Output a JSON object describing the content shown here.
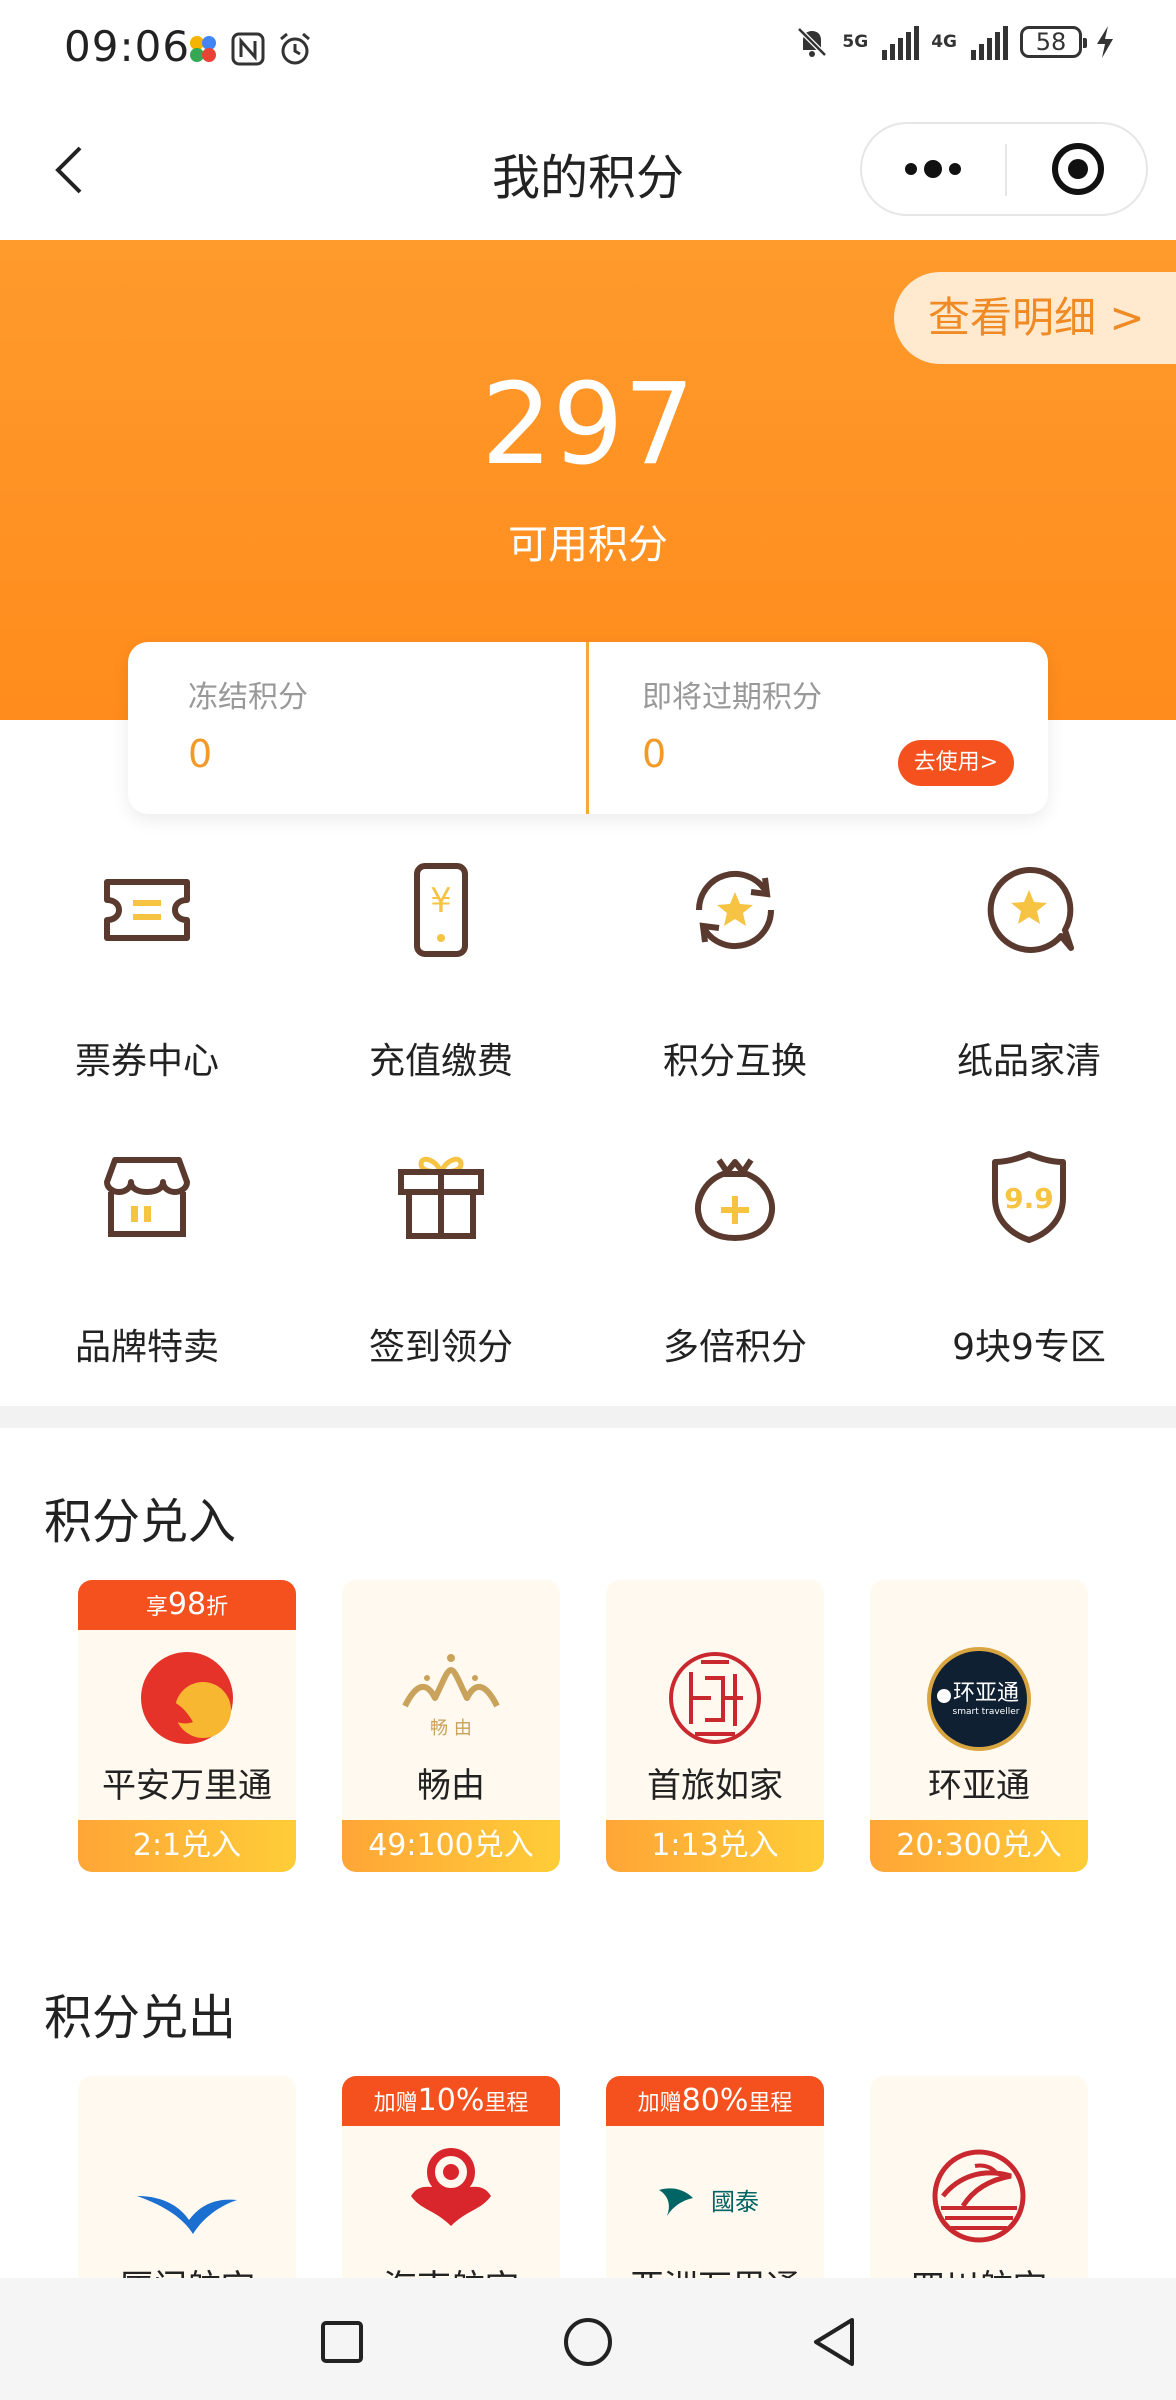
{
  "status_bar": {
    "time": "09:06",
    "net1": "5G",
    "net2": "4G",
    "battery": "58"
  },
  "nav": {
    "title": "我的积分"
  },
  "hero": {
    "detail_label": "查看明细 >",
    "points": "297",
    "points_label": "可用积分"
  },
  "summary": {
    "frozen_label": "冻结积分",
    "frozen_value": "0",
    "expiring_label": "即将过期积分",
    "expiring_value": "0",
    "use_label": "去使用>"
  },
  "grid": [
    {
      "label": "票券中心",
      "icon": "ticket-icon"
    },
    {
      "label": "充值缴费",
      "icon": "phone-recharge-icon"
    },
    {
      "label": "积分互换",
      "icon": "star-exchange-icon"
    },
    {
      "label": "纸品家清",
      "icon": "star-chat-icon"
    },
    {
      "label": "品牌特卖",
      "icon": "store-icon"
    },
    {
      "label": "签到领分",
      "icon": "gift-icon"
    },
    {
      "label": "多倍积分",
      "icon": "money-bag-icon"
    },
    {
      "label": "9块9专区",
      "icon": "shield-99-icon",
      "icon_text": "9.9"
    }
  ],
  "exchange_in": {
    "title": "积分兑入",
    "cards": [
      {
        "name": "平安万里通",
        "rate": "2:1兑入",
        "badge_prefix": "享",
        "badge_big": "98",
        "badge_suffix": "折"
      },
      {
        "name": "畅由",
        "rate": "49:100兑入",
        "logo_text": "畅 由"
      },
      {
        "name": "首旅如家",
        "rate": "1:13兑入"
      },
      {
        "name": "环亚通",
        "rate": "20:300兑入",
        "logo_text": "环亚通",
        "logo_sub": "smart traveller"
      }
    ]
  },
  "exchange_out": {
    "title": "积分兑出",
    "cards": [
      {
        "name": "厦门航空"
      },
      {
        "name": "海南航空",
        "badge_prefix": "加赠",
        "badge_big": "10%",
        "badge_suffix": "里程"
      },
      {
        "name": "亚洲万里通",
        "badge_prefix": "加赠",
        "badge_big": "80%",
        "badge_suffix": "里程",
        "logo_text": "國泰"
      },
      {
        "name": "四川航空"
      }
    ]
  },
  "colors": {
    "orange": "#ff8c1c",
    "badge_red": "#f4511e",
    "icon_brown": "#5a3a2e",
    "icon_yellow": "#f6c343"
  }
}
